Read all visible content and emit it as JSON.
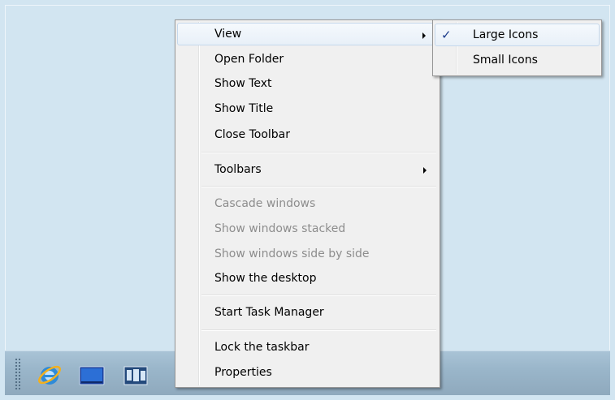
{
  "context_menu": {
    "items": [
      {
        "label": "View",
        "has_submenu": true,
        "highlighted": true
      },
      {
        "label": "Open Folder"
      },
      {
        "label": "Show Text"
      },
      {
        "label": "Show Title"
      },
      {
        "label": "Close Toolbar"
      },
      {
        "label": "Toolbars",
        "has_submenu": true
      },
      {
        "label": "Cascade windows",
        "disabled": true
      },
      {
        "label": "Show windows stacked",
        "disabled": true
      },
      {
        "label": "Show windows side by side",
        "disabled": true
      },
      {
        "label": "Show the desktop"
      },
      {
        "label": "Start Task Manager"
      },
      {
        "label": "Lock the taskbar"
      },
      {
        "label": "Properties"
      }
    ]
  },
  "view_submenu": {
    "items": [
      {
        "label": "Large Icons",
        "checked": true
      },
      {
        "label": "Small Icons"
      }
    ],
    "check_mark": "✓"
  },
  "taskbar": {
    "icons": [
      "internet-explorer-icon",
      "show-desktop-icon",
      "switch-windows-icon"
    ]
  },
  "colors": {
    "desktop": "#d2e5f1",
    "taskbar": "#9ab6ca",
    "menu_bg": "#f0f0f0",
    "disabled_text": "#8d8d8d"
  }
}
